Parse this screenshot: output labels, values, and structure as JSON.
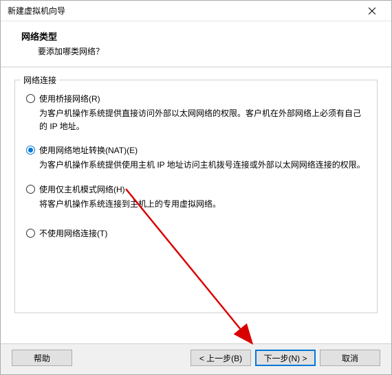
{
  "window": {
    "title": "新建虚拟机向导"
  },
  "header": {
    "title": "网络类型",
    "subtitle": "要添加哪类网络？"
  },
  "fieldset": {
    "label": "网络连接"
  },
  "options": {
    "bridge": {
      "label": "使用桥接网络(R)",
      "desc": "为客户机操作系统提供直接访问外部以太网网络的权限。客户机在外部网络上必须有自己的 IP 地址。"
    },
    "nat": {
      "label": "使用网络地址转换(NAT)(E)",
      "desc": "为客户机操作系统提供使用主机 IP 地址访问主机拨号连接或外部以太网网络连接的权限。"
    },
    "hostonly": {
      "label": "使用仅主机模式网络(H)",
      "desc": "将客户机操作系统连接到主机上的专用虚拟网络。"
    },
    "none": {
      "label": "不使用网络连接(T)"
    }
  },
  "footer": {
    "help": "帮助",
    "back": "< 上一步(B)",
    "next": "下一步(N) >",
    "cancel": "取消"
  }
}
